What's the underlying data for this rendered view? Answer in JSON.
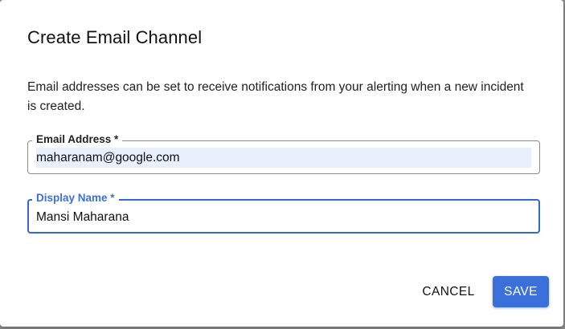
{
  "dialog": {
    "title": "Create Email Channel",
    "description": "Email addresses can be set to receive notifications from your alerting when a new incident is created."
  },
  "fields": {
    "email": {
      "label": "Email Address *",
      "value": "maharanam@google.com"
    },
    "display_name": {
      "label": "Display Name *",
      "value": "Mansi Maharana"
    }
  },
  "actions": {
    "cancel_label": "CANCEL",
    "save_label": "SAVE"
  },
  "colors": {
    "accent": "#3b6fd9",
    "autofill_background": "#e8f0fe"
  }
}
